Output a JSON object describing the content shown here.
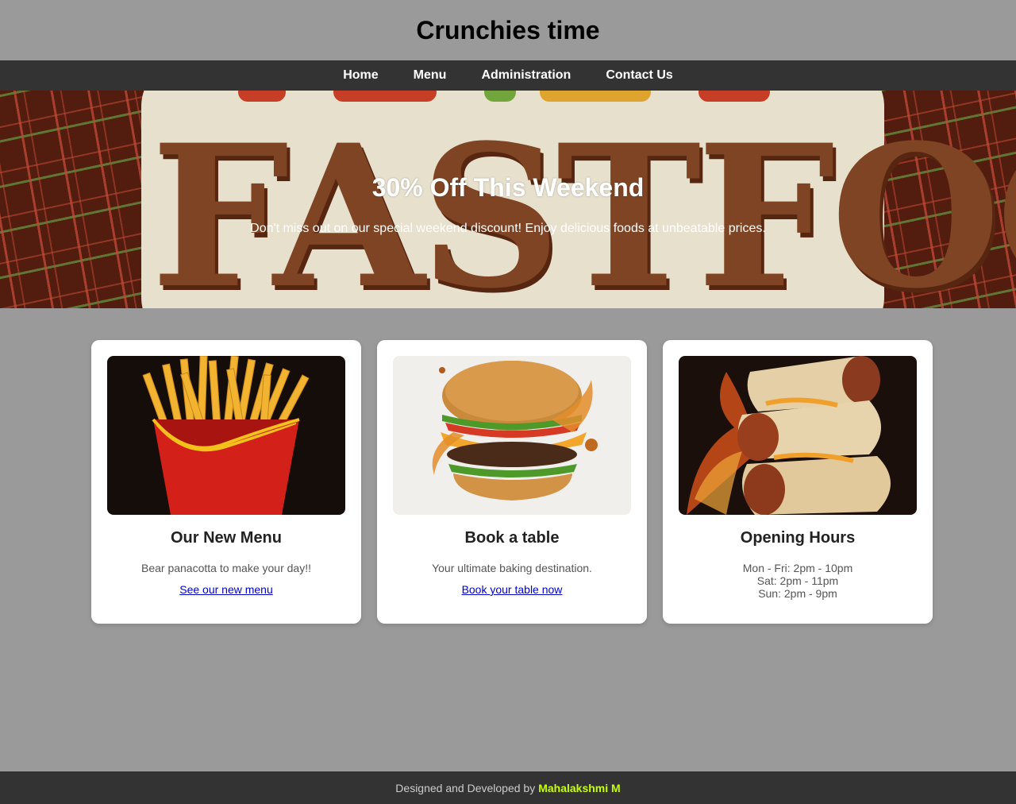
{
  "site": {
    "title": "Crunchies time"
  },
  "nav": {
    "items": [
      "Home",
      "Menu",
      "Administration",
      "Contact Us"
    ]
  },
  "hero": {
    "logo_text": "FASTFOOD",
    "title": "30% Off This Weekend",
    "text": "Don't miss out on our special weekend discount! Enjoy delicious foods at unbeatable prices."
  },
  "cards": [
    {
      "title": "Our New Menu",
      "text": "Bear panacotta to make your day!!",
      "link": "See our new menu",
      "image": "fries-icon"
    },
    {
      "title": "Book a table",
      "text": "Your ultimate baking destination.",
      "link": "Book your table now",
      "image": "burger-icon"
    },
    {
      "title": "Opening Hours",
      "hours": [
        "Mon - Fri: 2pm - 10pm",
        "Sat: 2pm - 11pm",
        "Sun: 2pm - 9pm"
      ],
      "image": "burrito-icon"
    }
  ],
  "footer": {
    "prefix": "Designed and Developed by",
    "author": "Mahalakshmi M"
  },
  "colors": {
    "background": "#9a9a9a",
    "nav": "#333333",
    "footer_author": "#c8ff00",
    "link": "#0000cc"
  }
}
